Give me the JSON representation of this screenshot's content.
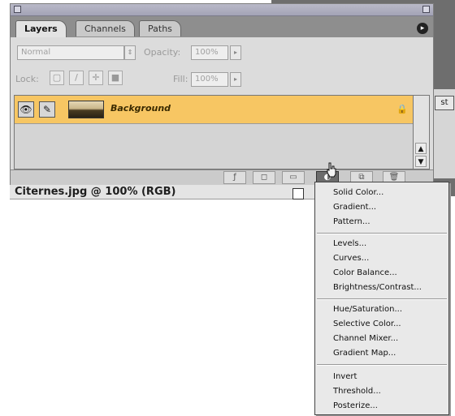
{
  "palette": {
    "tabs": [
      "Layers",
      "Channels",
      "Paths"
    ],
    "blend_mode": "Normal",
    "opacity_label": "Opacity:",
    "opacity_value": "100%",
    "lock_label": "Lock:",
    "fill_label": "Fill:",
    "fill_value": "100%",
    "layer": {
      "name": "Background",
      "selected_color": "#f7c663"
    }
  },
  "status_bar": {
    "document": "Citernes.jpg @ 100% (RGB)"
  },
  "adjustment_menu": {
    "groups": [
      [
        "Solid Color...",
        "Gradient...",
        "Pattern..."
      ],
      [
        "Levels...",
        "Curves...",
        "Color Balance...",
        "Brightness/Contrast..."
      ],
      [
        "Hue/Saturation...",
        "Selective Color...",
        "Channel Mixer...",
        "Gradient Map..."
      ],
      [
        "Invert",
        "Threshold...",
        "Posterize..."
      ]
    ]
  },
  "icons": {
    "eye": "eye-icon",
    "brush": "brush-icon",
    "lock": "lock-icon",
    "menu": "palette-menu-icon"
  }
}
